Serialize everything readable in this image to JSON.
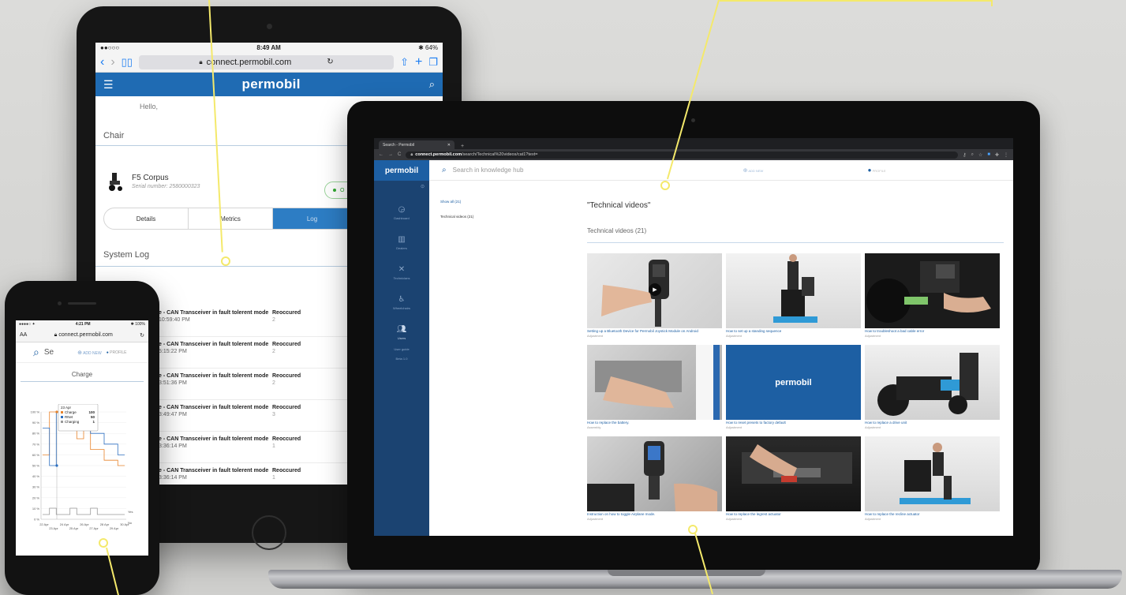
{
  "tablet": {
    "status": {
      "carrier": "●●○○○",
      "time": "8:49 AM",
      "battery": "✱ 64%"
    },
    "url": "connect.permobil.com",
    "brand": "permobil",
    "greeting": "Hello,",
    "chair_section": "Chair",
    "chair_name": "F5 Corpus",
    "serial": "Serial number: 2580000323",
    "status_pill": "O",
    "tabs": [
      "Details",
      "Metrics",
      "Log"
    ],
    "log_section": "System Log",
    "log_rows": [
      {
        "message": "e - CAN Transceiver in fault tolerent mode",
        "time": "10:59:40 PM",
        "status": "Reoccured",
        "count": "2"
      },
      {
        "message": "e - CAN Transceiver in fault tolerent mode",
        "time": "5:15:22 PM",
        "status": "Reoccured",
        "count": "2"
      },
      {
        "message": "e - CAN Transceiver in fault tolerent mode",
        "time": "3:51:36 PM",
        "status": "Reoccured",
        "count": "2"
      },
      {
        "message": "e - CAN Transceiver in fault tolerent mode",
        "time": "3:49:47 PM",
        "status": "Reoccured",
        "count": "3"
      },
      {
        "message": "e - CAN Transceiver in fault tolerent mode",
        "time": "3:36:14 PM",
        "status": "Reoccured",
        "count": "1"
      },
      {
        "message": "e - CAN Transceiver in fault tolerent mode",
        "time": "3:36:14 PM",
        "status": "Reoccured",
        "count": "1"
      }
    ]
  },
  "phone": {
    "status": {
      "carrier": "●●●●○ ✦",
      "time": "4:21 PM",
      "battery": "✱ 100%"
    },
    "text_size": "AA",
    "url": "connect.permobil.com",
    "search_placeholder": "Se",
    "add_new": "ADD NEW",
    "profile": "PROFILE",
    "chart_title": "Charge",
    "tooltip": {
      "date": "23 Apr",
      "rows": [
        {
          "label": "Charge",
          "value": "100",
          "color": "#e8832a"
        },
        {
          "label": "RNet",
          "value": "50",
          "color": "#2d6fc0"
        },
        {
          "label": "Charging",
          "value": "1",
          "color": "#999999"
        }
      ]
    }
  },
  "chart_data": {
    "type": "line",
    "title": "Charge",
    "y_ticks": [
      "100 %",
      "90 %",
      "80 %",
      "70 %",
      "60 %",
      "50 %",
      "40 %",
      "30 %",
      "20 %",
      "10 %",
      "0 %"
    ],
    "right_labels": [
      "Yes",
      "No"
    ],
    "x_ticks_top": [
      "22 Apr",
      "24 Apr",
      "26 Apr",
      "28 Apr",
      "30 Apr"
    ],
    "x_ticks_bottom": [
      "23 Apr",
      "25 Apr",
      "27 Apr",
      "29 Apr"
    ],
    "series": [
      {
        "name": "Charge",
        "color": "#e8832a",
        "values": [
          60,
          100,
          100,
          85,
          85,
          75,
          90,
          65,
          65,
          55,
          55,
          50,
          50
        ]
      },
      {
        "name": "RNet",
        "color": "#2d6fc0",
        "values": [
          85,
          50,
          100,
          95,
          95,
          90,
          95,
          80,
          80,
          70,
          70,
          60,
          60
        ]
      },
      {
        "name": "Charging",
        "color": "#999999",
        "values": [
          0,
          1,
          0,
          0,
          1,
          0,
          0,
          1,
          0,
          0,
          0,
          0,
          0
        ]
      }
    ],
    "ylim": [
      0,
      100
    ]
  },
  "laptop": {
    "tab_title": "Search - Permobil",
    "url_host": "connect.permobil.com",
    "url_path": "/search/Technical%20videos/cat1?text=",
    "brand": "permobil",
    "search_placeholder": "Search in knowledge hub",
    "add_new": "ADD NEW",
    "profile": "PROFILE",
    "sidebar": [
      "Dashboard",
      "Dealers",
      "Technicians",
      "Wheelchairs",
      "Users",
      "User guide",
      "Beta 1.0"
    ],
    "filters": {
      "all": "Show all (21)",
      "category": "Technical videos (21)"
    },
    "heading": "\"Technical videos\"",
    "subheading": "Technical videos (21)",
    "videos": [
      {
        "title": "Setting up a Bluetooth Device for Permobil Joystick Module on Android",
        "category": "Adjustment"
      },
      {
        "title": "How to set up a standing sequence",
        "category": "Adjustment"
      },
      {
        "title": "How to troubleshoot a bad cable error",
        "category": "Adjustment"
      },
      {
        "title": "How to replace the battery.",
        "category": "Assembly"
      },
      {
        "title": "How to reset presets to factory default",
        "category": "Adjustment"
      },
      {
        "title": "How to replace a drive unit",
        "category": "Adjustment"
      },
      {
        "title": "Instruction on how to toggle Airplane mode.",
        "category": "Adjustment"
      },
      {
        "title": "How to replace the legrest actuator",
        "category": "Adjustment"
      },
      {
        "title": "How to replace the recline actuator",
        "category": "Adjustment"
      }
    ],
    "thumb_brand": "permobil"
  },
  "colors": {
    "accent": "#1d5fa3",
    "annotation": "#f4e96b",
    "sidebar": "#1b4371"
  }
}
